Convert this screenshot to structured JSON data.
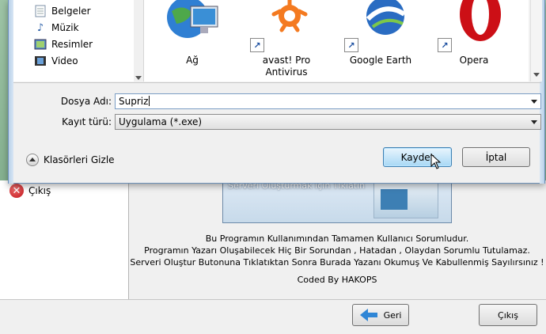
{
  "dialog": {
    "nav_items": [
      {
        "label": "Belgeler",
        "icon": "documents-icon"
      },
      {
        "label": "Müzik",
        "icon": "music-icon"
      },
      {
        "label": "Resimler",
        "icon": "pictures-icon"
      },
      {
        "label": "Video",
        "icon": "video-icon"
      }
    ],
    "files": [
      {
        "label": "Ağ",
        "icon": "network-icon",
        "shortcut": false
      },
      {
        "label": "avast! Pro Antivirus",
        "icon": "avast-icon",
        "shortcut": true
      },
      {
        "label": "Google Earth",
        "icon": "google-earth-icon",
        "shortcut": true
      },
      {
        "label": "Opera",
        "icon": "opera-icon",
        "shortcut": true
      }
    ],
    "filename_label": "Dosya Adı:",
    "filename_value": "Supriz",
    "filetype_label": "Kayıt türü:",
    "filetype_value": "Uygulama (*.exe)",
    "hide_folders_label": "Klasörleri Gizle",
    "save_label": "Kaydet",
    "cancel_label": "İptal"
  },
  "background_app": {
    "sidebar_exit_label": "Çıkış",
    "banner_text": "Serveri Oluşturmak İçin Tıklatın",
    "disclaimer_lines": [
      "Bu Programın Kullanımından Tamamen Kullanıcı Sorumludur.",
      "Programın Yazarı Oluşabilecek Hiç Bir Sorundan , Hatadan , Olaydan Sorumlu Tutulamaz.",
      "Serveri Oluştur Butonuna Tıklatıktan Sonra Burada Yazanı Okumuş Ve Kabullenmiş Sayılırsınız !"
    ],
    "credit": "Coded By HAKOPS",
    "back_label": "Geri",
    "exit_label": "Çıkış"
  },
  "colors": {
    "accent": "#3c7fb1",
    "exit_red": "#c0141a",
    "opera_red": "#cc0f16",
    "avast_orange": "#f47a20"
  }
}
